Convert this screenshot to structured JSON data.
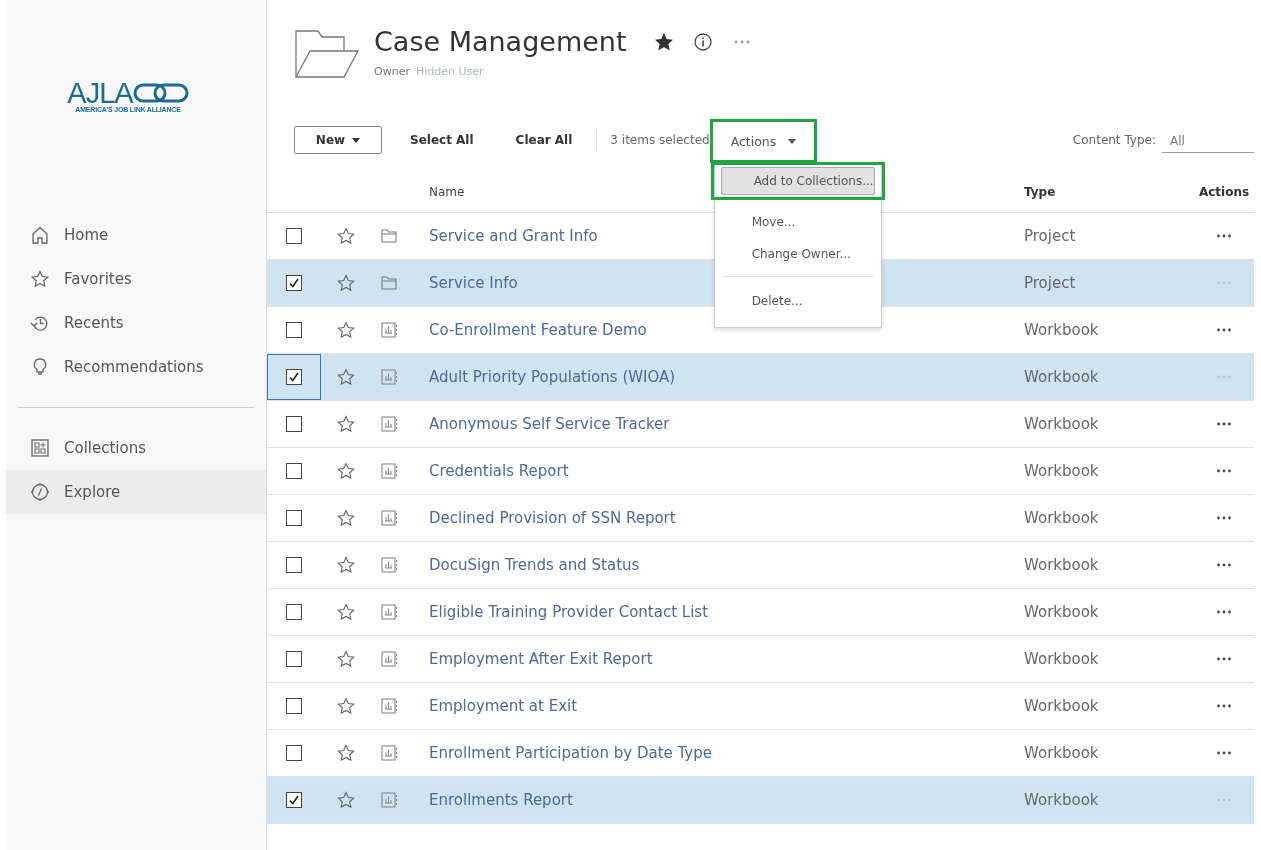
{
  "logo": {
    "wordmark": "AJLA",
    "tagline": "AMERICA'S JOB LINK ALLIANCE"
  },
  "sidebar": {
    "items": [
      {
        "kind": "home",
        "label": "Home",
        "selected": false
      },
      {
        "kind": "star",
        "label": "Favorites",
        "selected": false
      },
      {
        "kind": "recent",
        "label": "Recents",
        "selected": false
      },
      {
        "kind": "bulb",
        "label": "Recommendations",
        "selected": false
      },
      {
        "kind": "divider"
      },
      {
        "kind": "collections",
        "label": "Collections",
        "selected": false
      },
      {
        "kind": "explore",
        "label": "Explore",
        "selected": true
      }
    ]
  },
  "header": {
    "title": "Case Management",
    "favorite": true,
    "owner_label": "Owner",
    "owner": "Hidden User"
  },
  "toolbar": {
    "new_button": "New",
    "select_all": "Select All",
    "clear_all": "Clear All",
    "selection_count": "3 items selected",
    "actions_button": "Actions",
    "actions_highlighted": true,
    "content_type_label": "Content Type:",
    "content_type_value": "All"
  },
  "actions_menu": {
    "items": [
      {
        "kind": "item",
        "label": "Add to Collections...",
        "hovered": true,
        "highlighted": true
      },
      {
        "kind": "item",
        "label": "Move...",
        "hovered": false,
        "highlighted": false
      },
      {
        "kind": "item",
        "label": "Change Owner...",
        "hovered": false,
        "highlighted": false
      },
      {
        "kind": "divider"
      },
      {
        "kind": "item",
        "label": "Delete...",
        "hovered": false,
        "highlighted": false
      }
    ]
  },
  "table": {
    "columns": [
      "Name",
      "Type",
      "Actions"
    ],
    "rows": [
      {
        "kind": "project",
        "name": "Service and Grant Info",
        "type": "Project",
        "selected": false,
        "focused": false,
        "favorite": false
      },
      {
        "kind": "project",
        "name": "Service Info",
        "type": "Project",
        "selected": true,
        "focused": false,
        "favorite": false
      },
      {
        "kind": "workbook",
        "name": "Co-Enrollment Feature Demo",
        "type": "Workbook",
        "selected": false,
        "focused": false,
        "favorite": false
      },
      {
        "kind": "workbook",
        "name": "Adult Priority Populations (WIOA)",
        "type": "Workbook",
        "selected": true,
        "focused": true,
        "favorite": false
      },
      {
        "kind": "workbook",
        "name": "Anonymous Self Service Tracker",
        "type": "Workbook",
        "selected": false,
        "focused": false,
        "favorite": false
      },
      {
        "kind": "workbook",
        "name": "Credentials Report",
        "type": "Workbook",
        "selected": false,
        "focused": false,
        "favorite": false
      },
      {
        "kind": "workbook",
        "name": "Declined Provision of SSN Report",
        "type": "Workbook",
        "selected": false,
        "focused": false,
        "favorite": false
      },
      {
        "kind": "workbook",
        "name": "DocuSign Trends and Status",
        "type": "Workbook",
        "selected": false,
        "focused": false,
        "favorite": false
      },
      {
        "kind": "workbook",
        "name": "Eligible Training Provider Contact List",
        "type": "Workbook",
        "selected": false,
        "focused": false,
        "favorite": false
      },
      {
        "kind": "workbook",
        "name": "Employment After Exit Report",
        "type": "Workbook",
        "selected": false,
        "focused": false,
        "favorite": false
      },
      {
        "kind": "workbook",
        "name": "Employment at Exit",
        "type": "Workbook",
        "selected": false,
        "focused": false,
        "favorite": false
      },
      {
        "kind": "workbook",
        "name": "Enrollment Participation by Date Type",
        "type": "Workbook",
        "selected": false,
        "focused": false,
        "favorite": false
      },
      {
        "kind": "workbook",
        "name": "Enrollments Report",
        "type": "Workbook",
        "selected": true,
        "focused": false,
        "favorite": false
      }
    ]
  }
}
